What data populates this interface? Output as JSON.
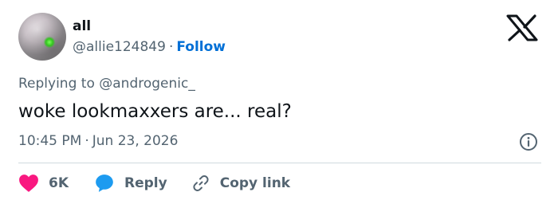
{
  "user": {
    "display_name": "all",
    "handle": "@allie124849",
    "separator": "·",
    "follow_label": "Follow"
  },
  "brand": {
    "logo_icon": "x-logo-icon",
    "color": "#0f1419"
  },
  "reply_context": {
    "prefix": "Replying to",
    "mention": "@androgenic_"
  },
  "tweet": {
    "text": "woke lookmaxxers are... real?",
    "time": "10:45 PM",
    "separator": "·",
    "date": "Jun 23, 2026",
    "info_icon": "info-icon"
  },
  "actions": {
    "like": {
      "icon": "heart-icon",
      "label": "6K",
      "color": "#f91880"
    },
    "reply": {
      "icon": "speech-bubble-icon",
      "label": "Reply",
      "color": "#1d9bf0"
    },
    "copy": {
      "icon": "link-icon",
      "label": "Copy link"
    }
  },
  "colors": {
    "text_primary": "#0f1419",
    "text_secondary": "#536471",
    "link": "#006fd6",
    "divider": "#cfd9de"
  }
}
